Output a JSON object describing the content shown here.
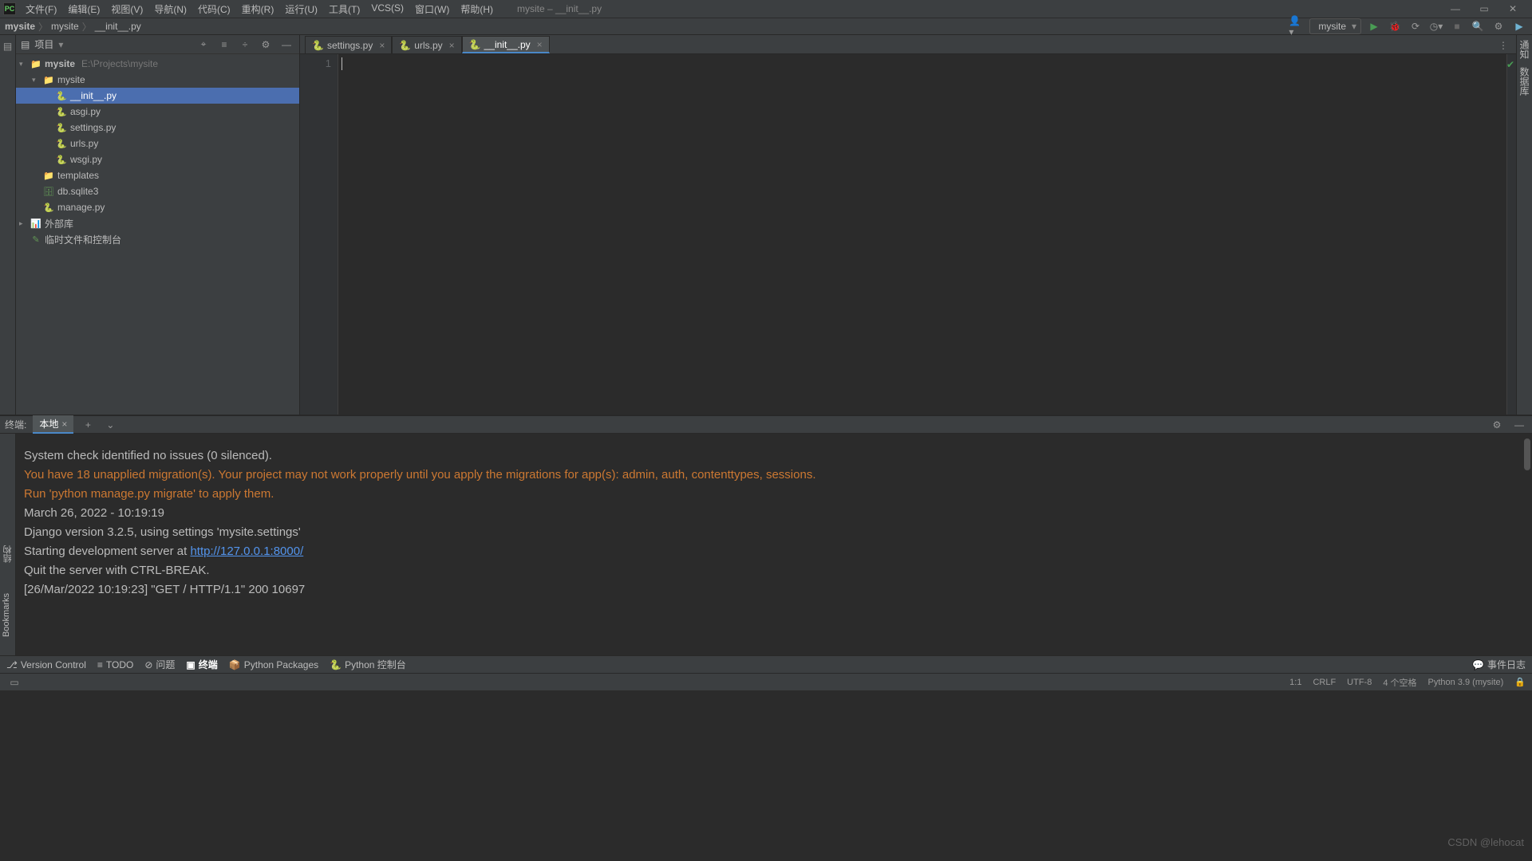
{
  "window": {
    "title": "mysite – __init__.py",
    "controls": {
      "min": "—",
      "max": "▭",
      "close": "✕"
    }
  },
  "menu": {
    "items": [
      "文件(F)",
      "编辑(E)",
      "视图(V)",
      "导航(N)",
      "代码(C)",
      "重构(R)",
      "运行(U)",
      "工具(T)",
      "VCS(S)",
      "窗口(W)",
      "帮助(H)"
    ]
  },
  "breadcrumb": {
    "parts": [
      "mysite",
      "mysite",
      "__init__.py"
    ]
  },
  "run": {
    "config": "mysite"
  },
  "project_panel": {
    "title": "项目",
    "tree": [
      {
        "depth": 0,
        "icon": "folder",
        "label": "mysite",
        "hint": "E:\\Projects\\mysite",
        "bold": true,
        "arrow": "▾"
      },
      {
        "depth": 1,
        "icon": "folder",
        "label": "mysite",
        "arrow": "▾"
      },
      {
        "depth": 2,
        "icon": "py",
        "label": "__init__.py",
        "selected": true
      },
      {
        "depth": 2,
        "icon": "py",
        "label": "asgi.py"
      },
      {
        "depth": 2,
        "icon": "py",
        "label": "settings.py"
      },
      {
        "depth": 2,
        "icon": "py",
        "label": "urls.py"
      },
      {
        "depth": 2,
        "icon": "py",
        "label": "wsgi.py"
      },
      {
        "depth": 1,
        "icon": "folder",
        "label": "templates"
      },
      {
        "depth": 1,
        "icon": "db",
        "label": "db.sqlite3"
      },
      {
        "depth": 1,
        "icon": "py",
        "label": "manage.py"
      },
      {
        "depth": 0,
        "icon": "lib",
        "label": "外部库",
        "arrow": "▸"
      },
      {
        "depth": 0,
        "icon": "scratch",
        "label": "临时文件和控制台"
      }
    ]
  },
  "editor": {
    "tabs": [
      {
        "label": "settings.py",
        "active": false
      },
      {
        "label": "urls.py",
        "active": false
      },
      {
        "label": "__init__.py",
        "active": true
      }
    ],
    "line_number": "1"
  },
  "terminal": {
    "title": "终端:",
    "tab": "本地",
    "lines": [
      {
        "text": "",
        "cls": ""
      },
      {
        "text": "System check identified no issues (0 silenced).",
        "cls": ""
      },
      {
        "text": "",
        "cls": ""
      },
      {
        "text": "You have 18 unapplied migration(s). Your project may not work properly until you apply the migrations for app(s): admin, auth, contenttypes, sessions.",
        "cls": "warn"
      },
      {
        "text": "Run 'python manage.py migrate' to apply them.",
        "cls": "warn"
      },
      {
        "text": "March 26, 2022 - 10:19:19",
        "cls": ""
      },
      {
        "text": "Django version 3.2.5, using settings 'mysite.settings'",
        "cls": ""
      },
      {
        "text": "Starting development server at ",
        "cls": "",
        "link": "http://127.0.0.1:8000/"
      },
      {
        "text": "Quit the server with CTRL-BREAK.",
        "cls": ""
      },
      {
        "text": "[26/Mar/2022 10:19:23] \"GET / HTTP/1.1\" 200 10697",
        "cls": ""
      }
    ]
  },
  "bottom_tabs": {
    "items": [
      "Version Control",
      "TODO",
      "问题",
      "终端",
      "Python Packages",
      "Python 控制台"
    ],
    "active": "终端",
    "right_label": "事件日志"
  },
  "status": {
    "pos": "1:1",
    "eol": "CRLF",
    "enc": "UTF-8",
    "indent": "4 个空格",
    "python": "Python 3.9 (mysite)",
    "lock": "🔒"
  },
  "left_tool": {
    "structure": "结构",
    "bookmarks": "Bookmarks"
  },
  "right_tool": {
    "notifications": "通知",
    "db": "数据库"
  },
  "watermark": "CSDN @lehocat"
}
